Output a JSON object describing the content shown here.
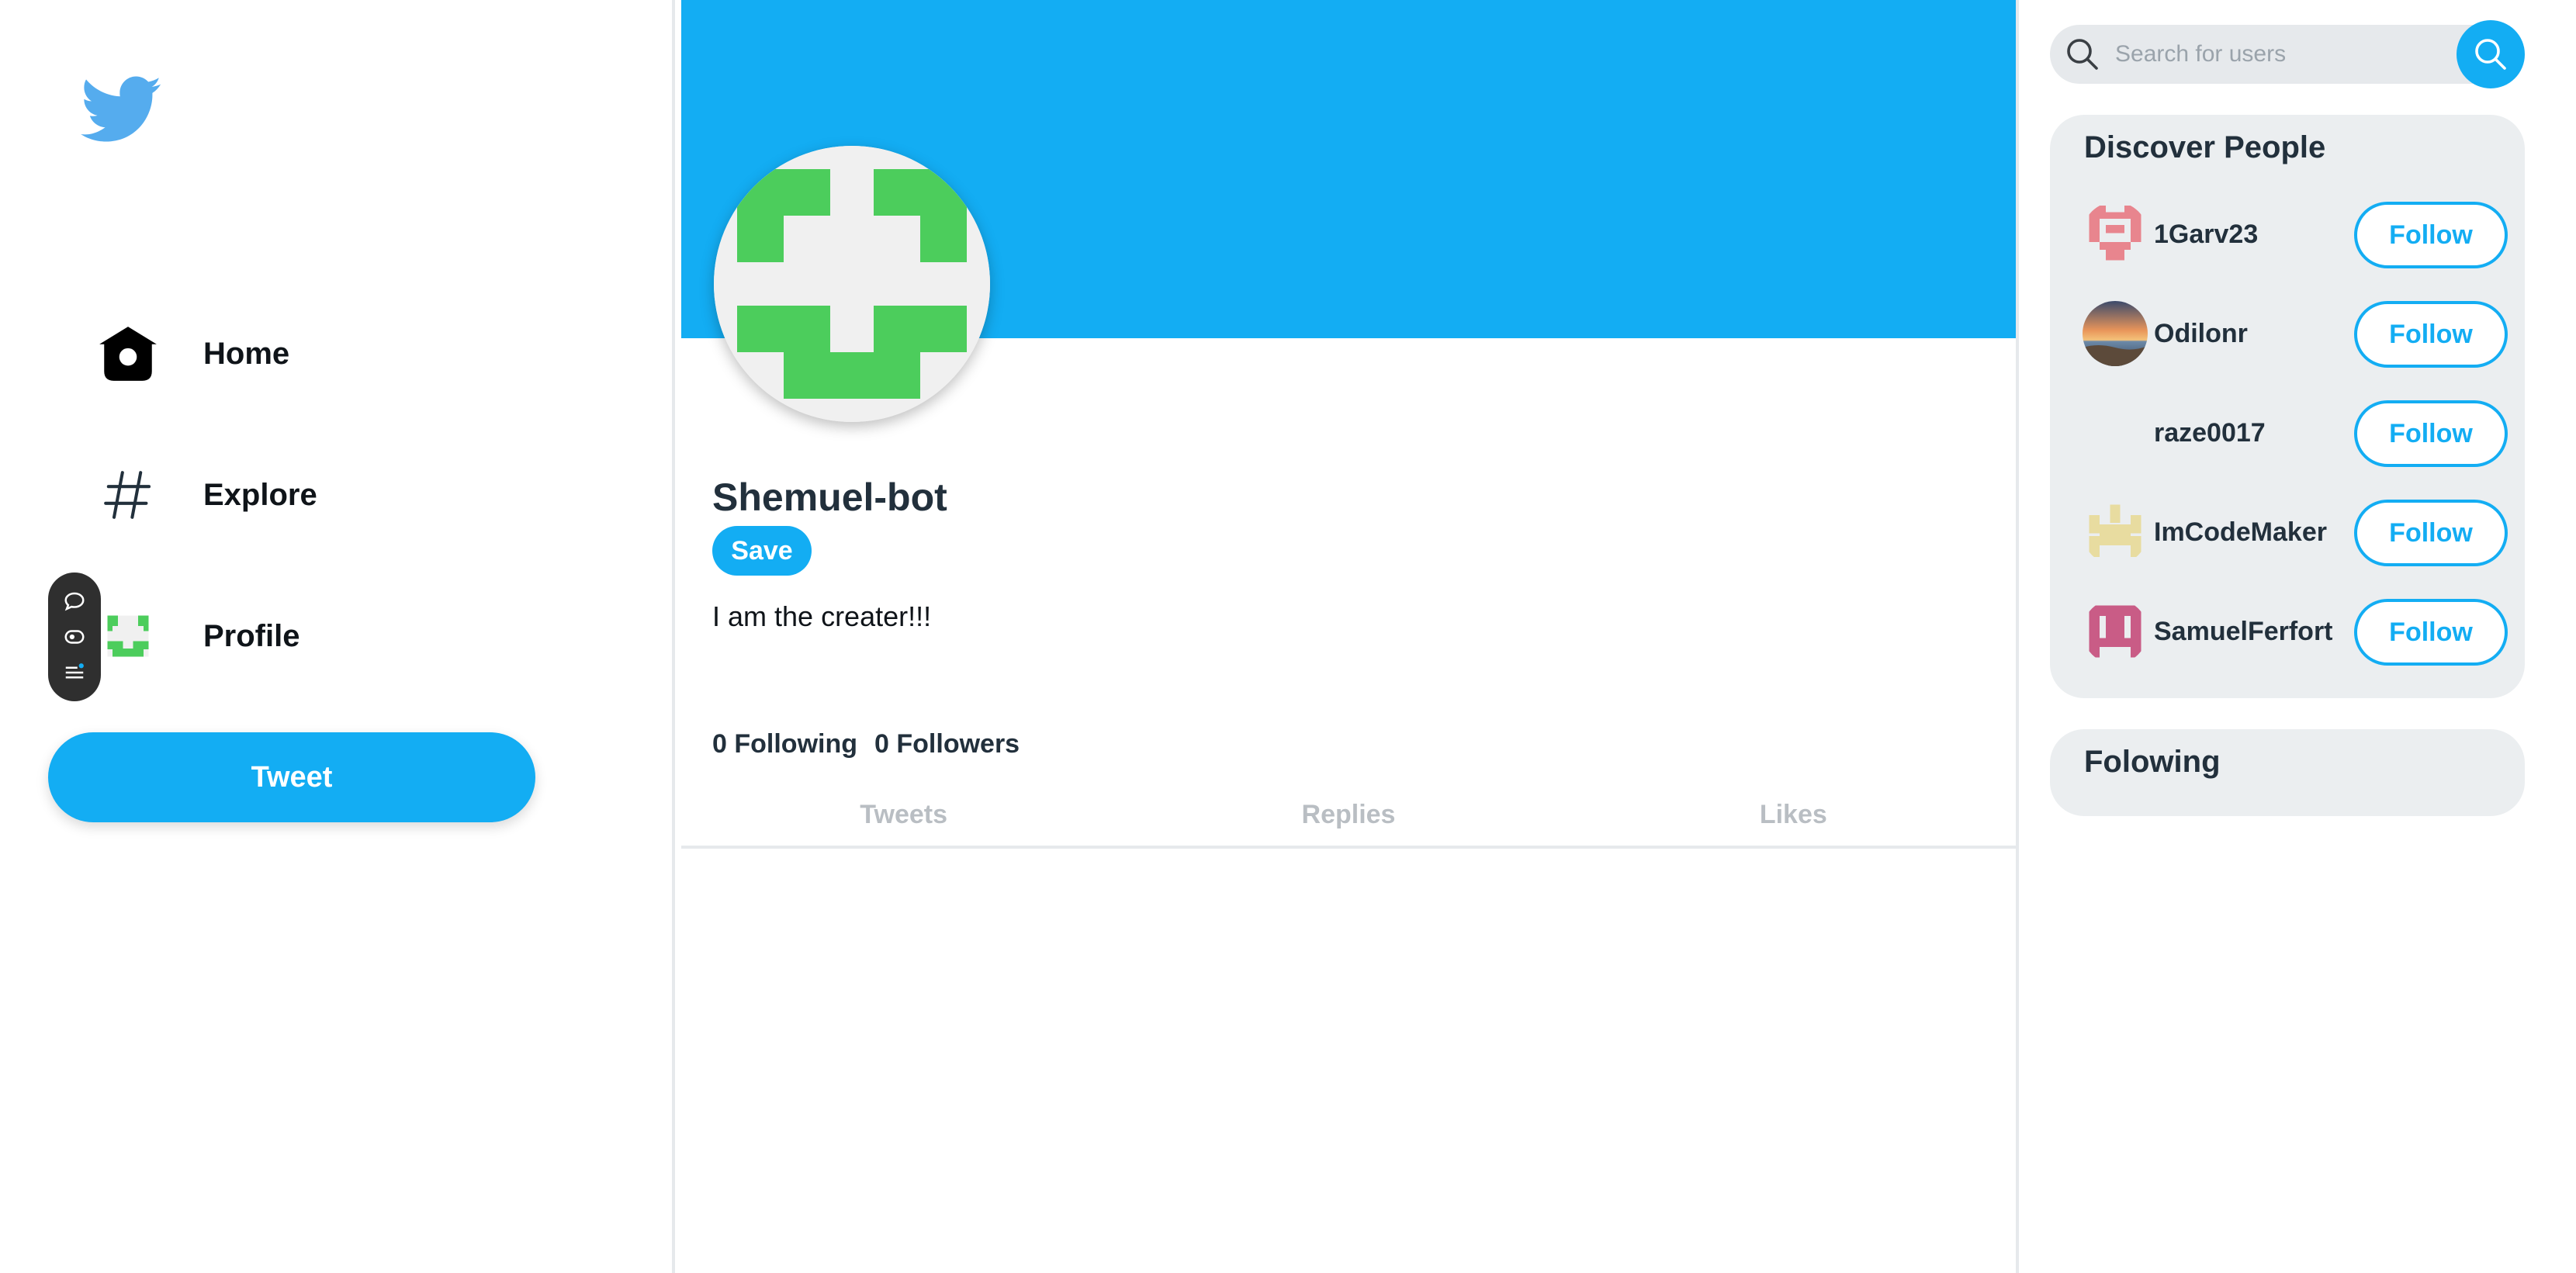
{
  "nav": {
    "logo": "twitter-bird-logo",
    "items": [
      {
        "label": "Home",
        "icon": "home-icon"
      },
      {
        "label": "Explore",
        "icon": "hashtag-icon"
      },
      {
        "label": "Profile",
        "icon": "profile-identicon"
      }
    ],
    "tweet_label": "Tweet"
  },
  "floating_toolbar": {
    "icons": [
      "chat-bubble-icon",
      "eye-icon",
      "list-icon"
    ]
  },
  "profile": {
    "display_name": "Shemuel-bot",
    "save_label": "Save",
    "bio": "I am the creater!!!",
    "following_count": "0",
    "following_label": "Following",
    "followers_count": "0",
    "followers_label": "Followers",
    "tabs": [
      "Tweets",
      "Replies",
      "Likes"
    ]
  },
  "search": {
    "placeholder": "Search for users"
  },
  "discover": {
    "title": "Discover People",
    "follow_label": "Follow",
    "users": [
      {
        "name": "1Garv23",
        "avatar": "pink-identicon"
      },
      {
        "name": "Odilonr",
        "avatar": "sunset-photo"
      },
      {
        "name": "raze0017",
        "avatar": "blank"
      },
      {
        "name": "ImCodeMaker",
        "avatar": "yellow-identicon"
      },
      {
        "name": "SamuelFerfort",
        "avatar": "magenta-identicon"
      }
    ]
  },
  "following_card": {
    "title": "Folowing"
  },
  "colors": {
    "accent": "#13adf3",
    "card_bg": "#ebeef0",
    "identicon_green": "#4ccd5c"
  }
}
